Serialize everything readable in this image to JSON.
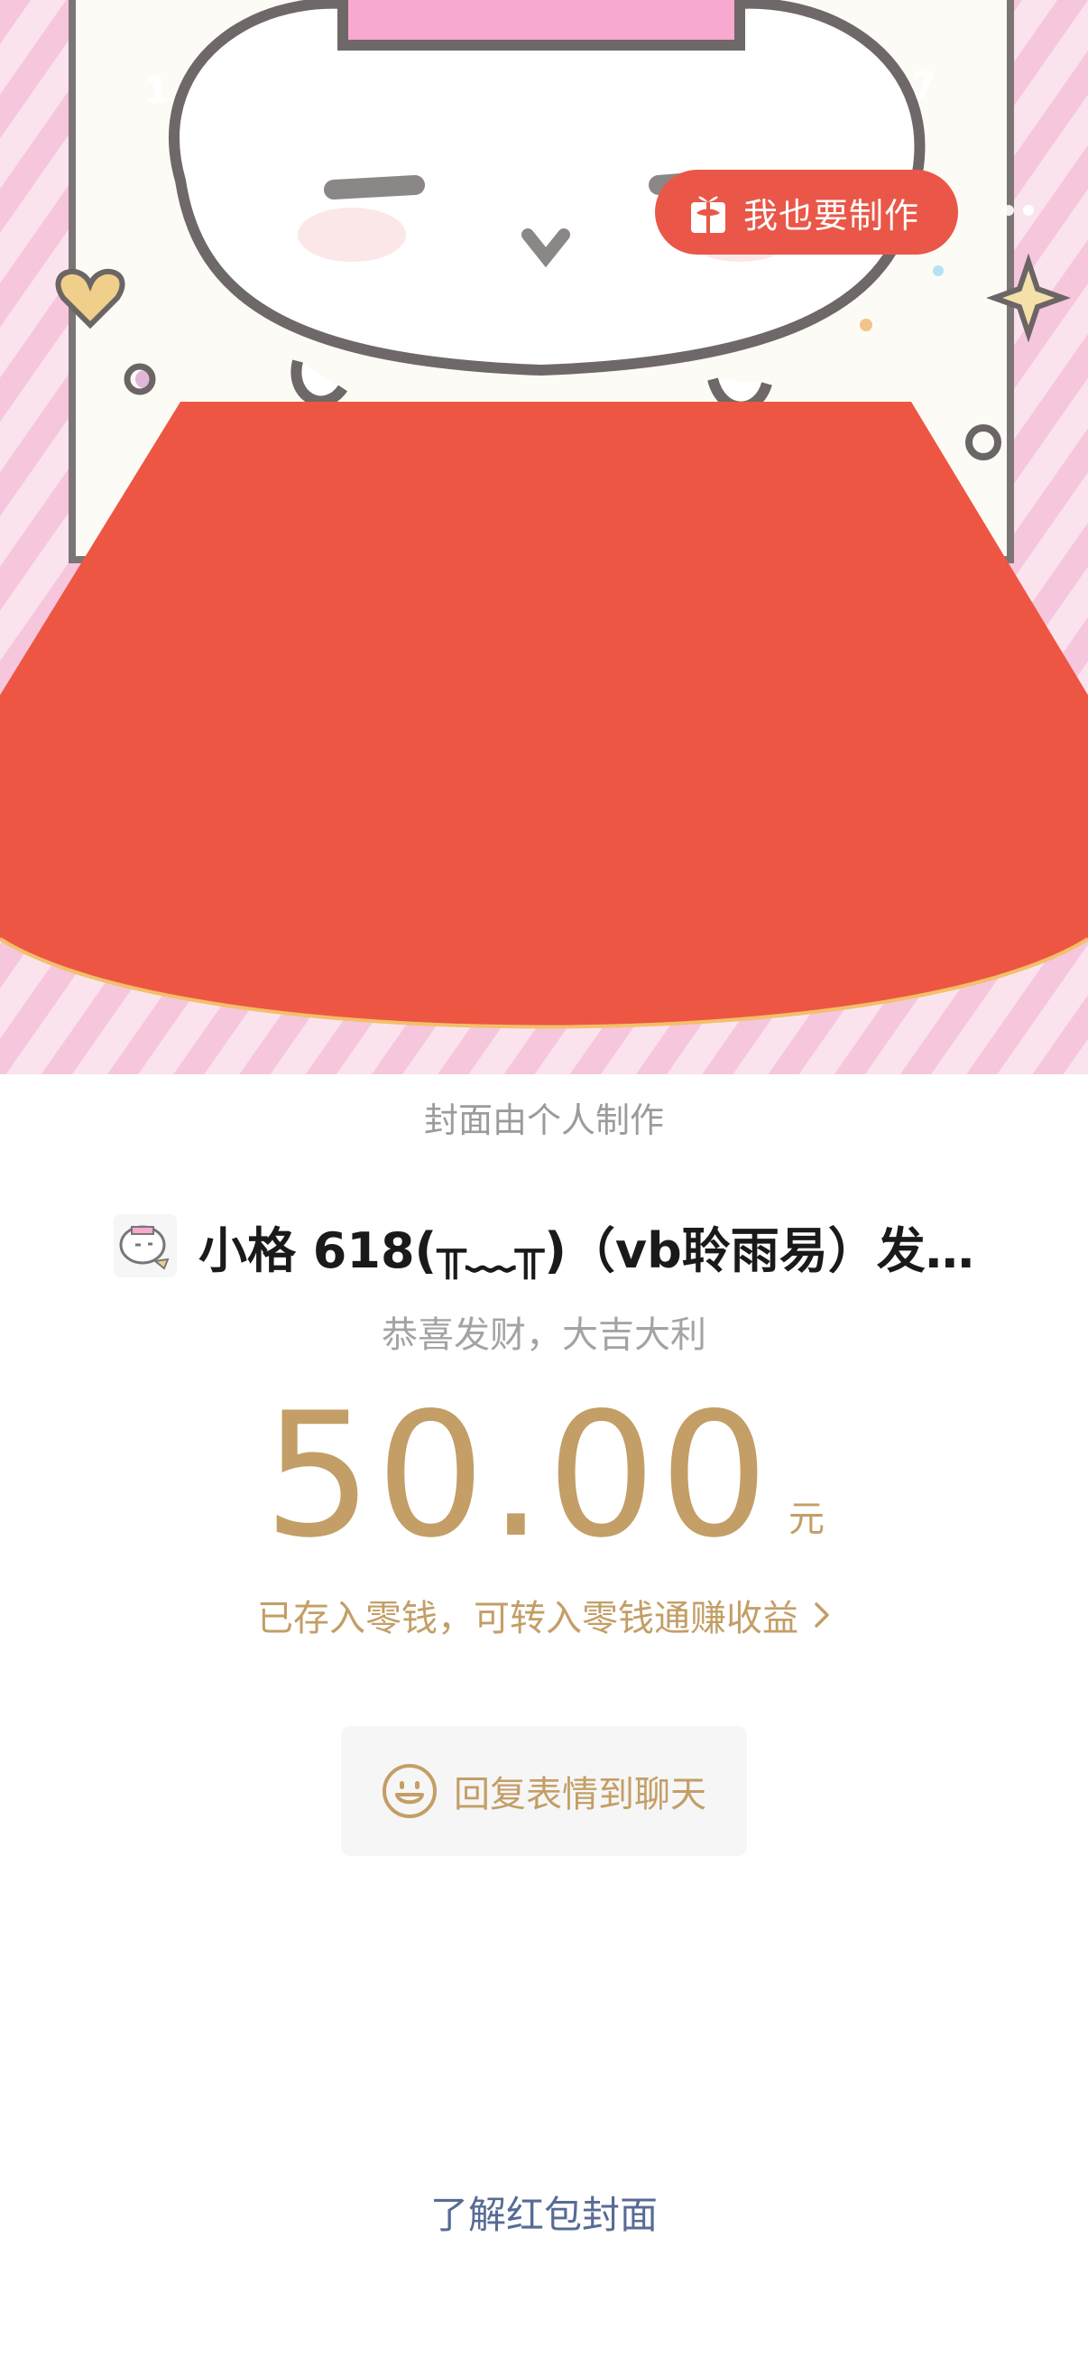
{
  "status_bar": {
    "time_fragment": "1",
    "right_fragment": "7"
  },
  "cover": {
    "make_button_label": "我也要制作",
    "note": "封面由个人制作"
  },
  "sender": {
    "name": "小格 618(╥﹏╥)（vb聆雨易）发…",
    "greeting": "恭喜发财，大吉大利"
  },
  "amount": {
    "value": "50.00",
    "unit": "元"
  },
  "deposit_note": "已存入零钱，可转入零钱通赚收益",
  "reply_button_label": "回复表情到聊天",
  "learn_link": "了解红包封面",
  "colors": {
    "envelope_red": "#ee5644",
    "gold_text": "#c39e66",
    "button_red": "#ea5748",
    "link_blue": "#576b95"
  }
}
